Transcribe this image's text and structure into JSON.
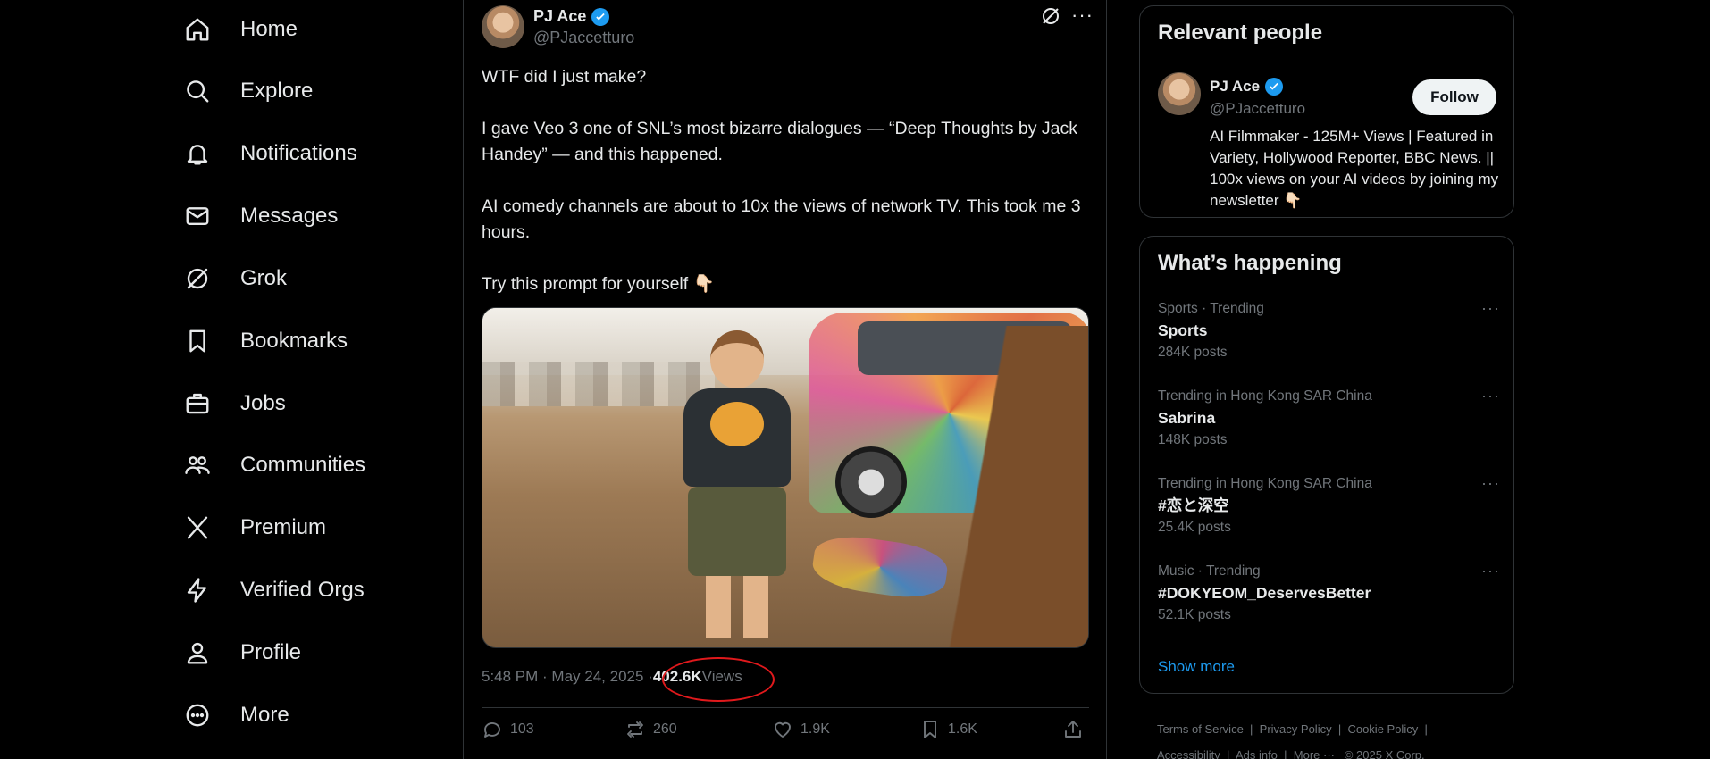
{
  "nav": {
    "items": [
      {
        "label": "Home",
        "icon": "home-icon"
      },
      {
        "label": "Explore",
        "icon": "search-icon"
      },
      {
        "label": "Notifications",
        "icon": "bell-icon"
      },
      {
        "label": "Messages",
        "icon": "envelope-icon"
      },
      {
        "label": "Grok",
        "icon": "grok-icon"
      },
      {
        "label": "Bookmarks",
        "icon": "bookmark-icon"
      },
      {
        "label": "Jobs",
        "icon": "briefcase-icon"
      },
      {
        "label": "Communities",
        "icon": "people-icon"
      },
      {
        "label": "Premium",
        "icon": "x-logo-icon"
      },
      {
        "label": "Verified Orgs",
        "icon": "lightning-icon"
      },
      {
        "label": "Profile",
        "icon": "person-icon"
      },
      {
        "label": "More",
        "icon": "more-circle-icon"
      }
    ]
  },
  "post": {
    "author_name": "PJ Ace",
    "author_handle": "@PJaccetturo",
    "paragraphs": [
      "WTF did I just make?",
      "I gave Veo 3 one of SNL’s most bizarre dialogues — “Deep Thoughts by Jack Handey” — and this happened.",
      "AI comedy channels are about to 10x the views of network TV. This took me 3 hours.",
      "Try this prompt for yourself 👇🏻"
    ],
    "time": "5:48 PM · May 24, 2025 · ",
    "views_count": "402.6K",
    "views_label": " Views",
    "actions": {
      "replies": "103",
      "reposts": "260",
      "likes": "1.9K",
      "bookmarks": "1.6K"
    }
  },
  "relevant_people": {
    "title": "Relevant people",
    "name": "PJ Ace",
    "handle": "@PJaccetturo",
    "follow_label": "Follow",
    "bio": "AI Filmmaker - 125M+ Views | Featured in Variety, Hollywood Reporter, BBC News. || 100x views on your AI videos by joining my newsletter 👇🏻"
  },
  "whats_happening": {
    "title": "What’s happening",
    "trends": [
      {
        "context": "Sports · Trending",
        "name": "Sports",
        "count": "284K posts"
      },
      {
        "context": "Trending in Hong Kong SAR China",
        "name": "Sabrina",
        "count": "148K posts"
      },
      {
        "context": "Trending in Hong Kong SAR China",
        "name": "#恋と深空",
        "count": "25.4K posts"
      },
      {
        "context": "Music · Trending",
        "name": "#DOKYEOM_DeservesBetter",
        "count": "52.1K posts"
      }
    ],
    "show_more": "Show more"
  },
  "footer": {
    "terms": "Terms of Service",
    "privacy": "Privacy Policy",
    "cookie": "Cookie Policy",
    "accessibility": "Accessibility",
    "ads": "Ads info",
    "more": "More ···",
    "copyright": "© 2025 X Corp.",
    "separator": "|"
  },
  "colors": {
    "background": "#000000",
    "text": "#e7e9ea",
    "muted": "#71767b",
    "accent": "#1d9bf0",
    "annotation_circle": "#e0191c"
  }
}
